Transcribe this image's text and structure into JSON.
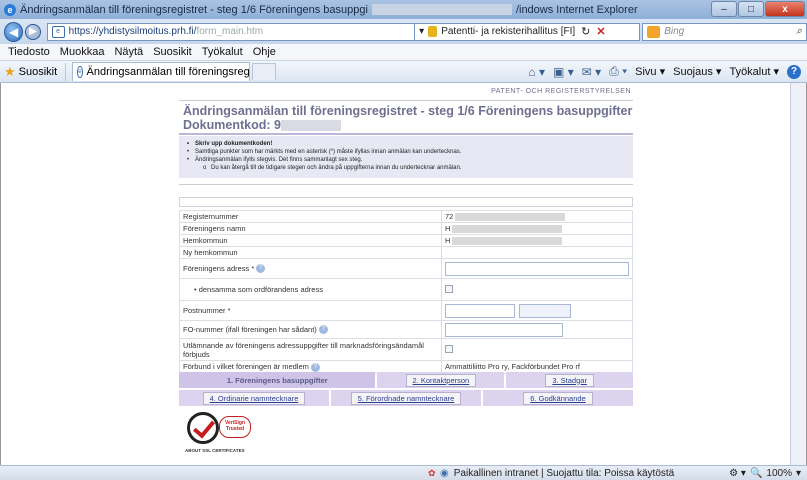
{
  "window": {
    "title_start": "Ändringsanmälan till föreningsregistret - steg 1/6 Föreningens basuppgi",
    "title_end": "/indows Internet Explorer",
    "min_label": "–",
    "max_label": "□",
    "close_label": "x"
  },
  "addressbar": {
    "url_main": "https://yhdistysilmoitus.prh.fi/",
    "url_faded": "form_main.htm",
    "security_label": "Patentti- ja rekisterihallitus [FI]",
    "search_placeholder": "Bing"
  },
  "menu": [
    "Tiedosto",
    "Muokkaa",
    "Näytä",
    "Suosikit",
    "Työkalut",
    "Ohje"
  ],
  "favorites": {
    "label": "Suosikit",
    "tab_title": "Ändringsanmälan till föreningsregistr..."
  },
  "commands": {
    "page": "Sivu ▾",
    "safety": "Suojaus ▾",
    "tools": "Työkalut ▾"
  },
  "page": {
    "agency": "PATENT- OCH REGISTERSTYRELSEN",
    "title": "Ändringsanmälan till föreningsregistret - steg 1/6 Föreningens basuppgifter",
    "code_label": "Dokumentkod: 9",
    "info": {
      "bold_item": "Skriv upp dokumentkoden!",
      "items": [
        "Samtliga punkter som har märkts med en asterisk (*) måste ifyllas innan anmälan kan undertecknas.",
        "Ändringsanmälan ifylls stegvis. Det finns sammanlagt sex steg."
      ],
      "sub_item": "Du kan återgå till de tidigare stegen och ändra på uppgifterna innan du undertecknar anmälan."
    },
    "form": {
      "registernummer": "Registernummer",
      "registernummer_value": "72",
      "namn": "Föreningens namn",
      "namn_value": "H",
      "hemkommun": "Hemkommun",
      "hemkommun_value": "H",
      "ny_hemkommun": "Ny hemkommun",
      "adress": "Föreningens adress *",
      "densamma": "densamma som ordförandens adress",
      "postnummer": "Postnummer *",
      "fo_nummer": "FO-nummer (ifall föreningen har sådant)",
      "utlamnande": "Utlämnande av föreningens adressuppgifter till marknadsföringsändamål förbjuds",
      "forbund": "Förbund i vilket föreningen är medlem",
      "forbund_value": "Ammattiliitto Pro ry, Fackförbundet Pro rf"
    },
    "steps": [
      "1. Föreningens basuppgifter",
      "2. Kontaktperson",
      "3. Stadgar",
      "4. Ordinarie namntecknare",
      "5. Förordnade namntecknare",
      "6. Godkännande"
    ],
    "seal": {
      "brand": "VeriSign Trusted",
      "about": "ABOUT SSL CERTIFICATES"
    }
  },
  "status": {
    "zone": "Paikallinen intranet | Suojattu tila: Poissa käytöstä",
    "zoom": "100%"
  }
}
